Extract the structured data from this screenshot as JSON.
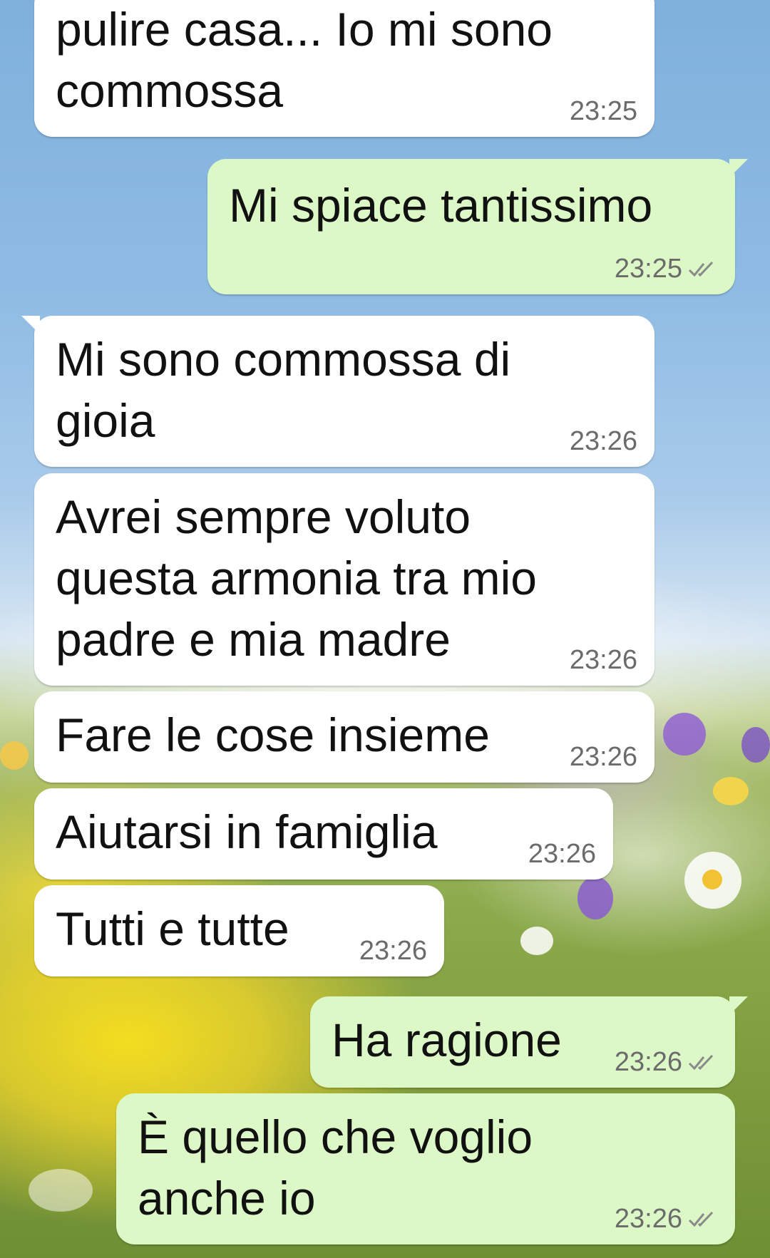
{
  "messages": [
    {
      "direction": "in",
      "text": "pulire casa... Io mi sono\ncommossa",
      "time": "23:25"
    },
    {
      "direction": "out",
      "text": "Mi spiace tantissimo",
      "time": "23:25",
      "status_icon": "double-check-icon"
    },
    {
      "direction": "in",
      "text": "Mi sono commossa di\ngioia",
      "time": "23:26"
    },
    {
      "direction": "in",
      "text": "Avrei sempre voluto\nquesta armonia tra mio\npadre e mia madre",
      "time": "23:26"
    },
    {
      "direction": "in",
      "text": "Fare le cose insieme",
      "time": "23:26"
    },
    {
      "direction": "in",
      "text": "Aiutarsi in famiglia",
      "time": "23:26"
    },
    {
      "direction": "in",
      "text": "Tutti e tutte",
      "time": "23:26"
    },
    {
      "direction": "out",
      "text": "Ha ragione",
      "time": "23:26",
      "status_icon": "double-check-icon"
    },
    {
      "direction": "out",
      "text": "È quello che voglio\nanche io",
      "time": "23:26",
      "status_icon": "double-check-icon"
    }
  ],
  "colors": {
    "incoming_bubble": "#ffffff",
    "outgoing_bubble": "#dcf8c6",
    "timestamp": "#6b6b6b"
  }
}
